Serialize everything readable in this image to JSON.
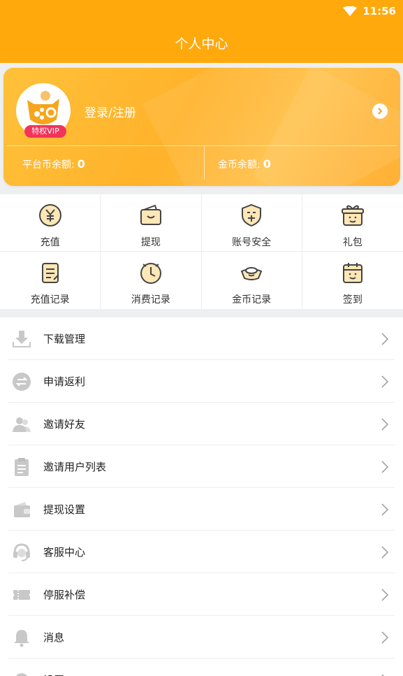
{
  "status_bar": {
    "time": "11:56",
    "wifi_icon": "wifi-icon"
  },
  "header": {
    "title": "个人中心"
  },
  "colors": {
    "brand_orange": "#ffa90c",
    "vip_pink": "#f2345a",
    "icon_orange": "#f0a01a"
  },
  "profile": {
    "login_label": "登录/注册",
    "vip_badge": "特权VIP",
    "platform_balance_label": "平台币余额:",
    "platform_balance_value": "0",
    "coin_balance_label": "金币余额:",
    "coin_balance_value": "0"
  },
  "grid": [
    {
      "label": "充值",
      "icon": "yen-coin-icon"
    },
    {
      "label": "提现",
      "icon": "wallet-icon"
    },
    {
      "label": "账号安全",
      "icon": "shield-icon"
    },
    {
      "label": "礼包",
      "icon": "gift-icon"
    },
    {
      "label": "充值记录",
      "icon": "record-icon"
    },
    {
      "label": "消费记录",
      "icon": "clock-icon"
    },
    {
      "label": "金币记录",
      "icon": "gold-ingot-icon"
    },
    {
      "label": "签到",
      "icon": "calendar-icon"
    }
  ],
  "menu": [
    {
      "label": "下载管理",
      "icon": "download-icon"
    },
    {
      "label": "申请返利",
      "icon": "exchange-icon"
    },
    {
      "label": "邀请好友",
      "icon": "friends-icon"
    },
    {
      "label": "邀请用户列表",
      "icon": "list-icon"
    },
    {
      "label": "提现设置",
      "icon": "wallet-icon"
    },
    {
      "label": "客服中心",
      "icon": "headset-icon"
    },
    {
      "label": "停服补偿",
      "icon": "ticket-icon"
    },
    {
      "label": "消息",
      "icon": "bell-icon"
    },
    {
      "label": "设置",
      "icon": "settings-icon"
    }
  ]
}
